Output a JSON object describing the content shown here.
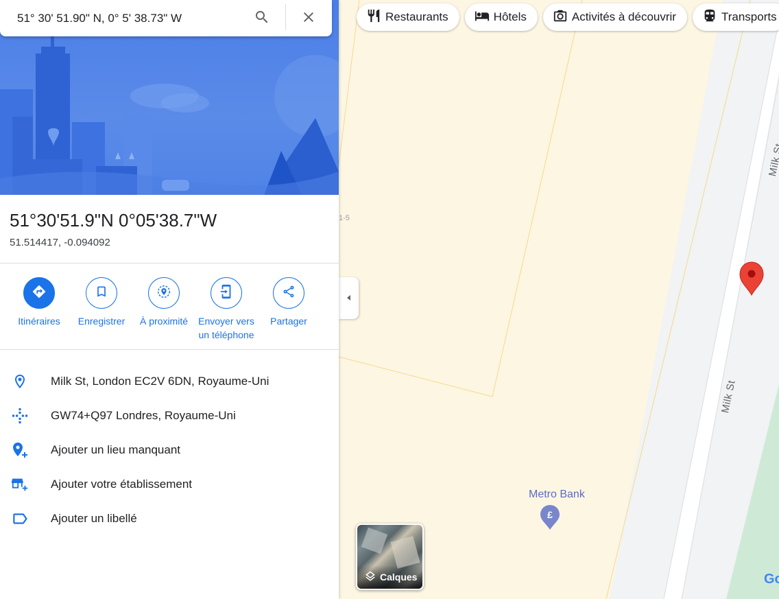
{
  "search": {
    "value": "51° 30' 51.90\" N, 0° 5' 38.73\" W"
  },
  "place": {
    "title": "51°30'51.9\"N 0°05'38.7\"W",
    "coords": "51.514417, -0.094092"
  },
  "actions": [
    {
      "label": "Itinéraires",
      "icon": "directions-icon"
    },
    {
      "label": "Enregistrer",
      "icon": "bookmark-icon"
    },
    {
      "label": "À proximité",
      "icon": "nearby-icon"
    },
    {
      "label": "Envoyer vers un téléphone",
      "label_line1": "Envoyer vers",
      "label_line2": "un téléphone",
      "icon": "send-to-phone-icon"
    },
    {
      "label": "Partager",
      "icon": "share-icon"
    }
  ],
  "info": [
    {
      "text": "Milk St, London EC2V 6DN, Royaume-Uni",
      "icon": "location-pin-icon"
    },
    {
      "text": "GW74+Q97 Londres, Royaume-Uni",
      "icon": "plus-code-icon"
    },
    {
      "text": "Ajouter un lieu manquant",
      "icon": "add-place-icon"
    },
    {
      "text": "Ajouter votre établissement",
      "icon": "add-business-icon"
    },
    {
      "text": "Ajouter un libellé",
      "icon": "label-icon"
    }
  ],
  "chips": [
    {
      "label": "Restaurants",
      "icon": "restaurant-icon"
    },
    {
      "label": "Hôtels",
      "icon": "hotel-icon"
    },
    {
      "label": "Activités à découvrir",
      "icon": "camera-icon"
    },
    {
      "label": "Transports",
      "icon": "transit-icon"
    }
  ],
  "map": {
    "street_name": "Milk St",
    "street_name_top": "Milk St",
    "address_number": "1-5",
    "poi": {
      "name": "Metro Bank",
      "icon": "pound-icon"
    },
    "layers_label": "Calques",
    "brand": "Go"
  },
  "colors": {
    "accent": "#1a73e8",
    "pin": "#ea4335",
    "poi": "#5c6bc0",
    "map_land": "#fdf6e3"
  }
}
